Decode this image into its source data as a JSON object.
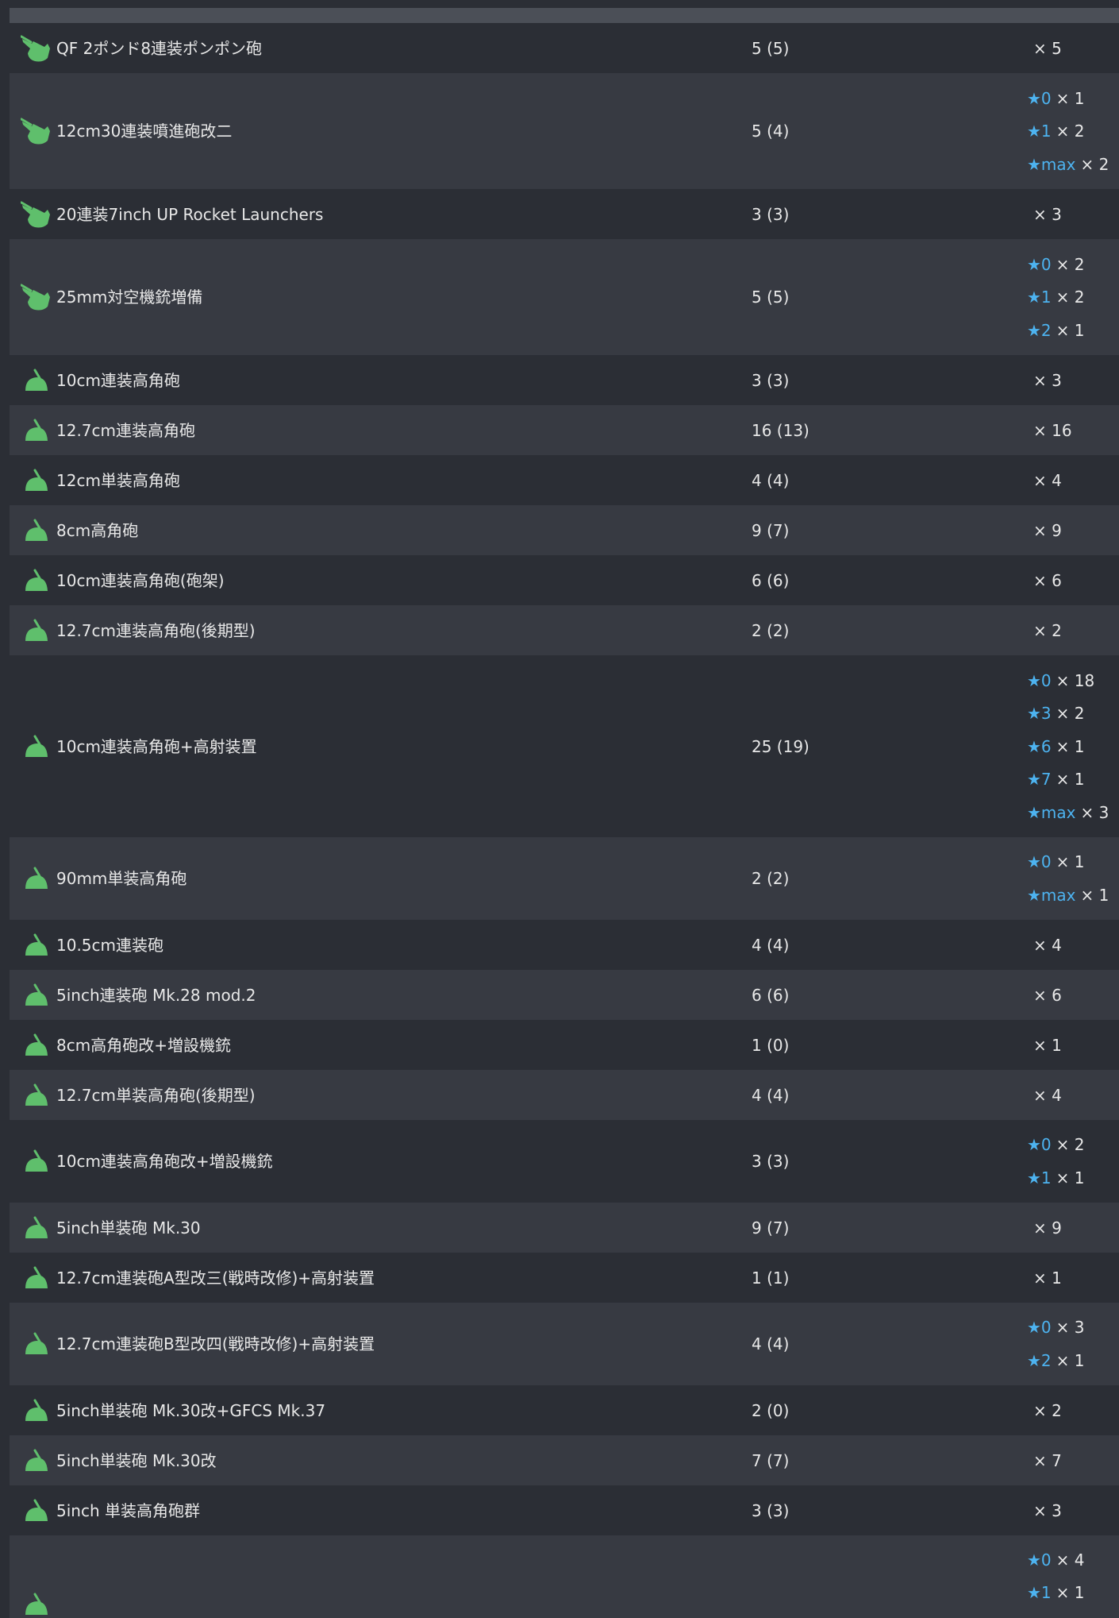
{
  "colors": {
    "background": "#2b2e35",
    "row_alt": "#373a42",
    "header_strip": "#4b4f57",
    "text": "#e8e8e8",
    "star": "#4db3f0",
    "icon_green": "#5fbf6c"
  },
  "rows": [
    {
      "icon": "machine-gun-icon",
      "name": "QF 2ポンド8連装ポンポン砲",
      "count": "5 (5)",
      "total": "× 5",
      "stars": []
    },
    {
      "icon": "machine-gun-icon",
      "name": "12cm30連装噴進砲改二",
      "count": "5 (4)",
      "total": "",
      "stars": [
        {
          "level": "★0",
          "qty": "× 1"
        },
        {
          "level": "★1",
          "qty": "× 2"
        },
        {
          "level": "★max",
          "qty": "× 2"
        }
      ]
    },
    {
      "icon": "machine-gun-icon",
      "name": "20連装7inch UP Rocket Launchers",
      "count": "3 (3)",
      "total": "× 3",
      "stars": []
    },
    {
      "icon": "machine-gun-icon",
      "name": "25mm対空機銃増備",
      "count": "5 (5)",
      "total": "",
      "stars": [
        {
          "level": "★0",
          "qty": "× 2"
        },
        {
          "level": "★1",
          "qty": "× 2"
        },
        {
          "level": "★2",
          "qty": "× 1"
        }
      ]
    },
    {
      "icon": "high-angle-gun-icon",
      "name": "10cm連装高角砲",
      "count": "3 (3)",
      "total": "× 3",
      "stars": []
    },
    {
      "icon": "high-angle-gun-icon",
      "name": "12.7cm連装高角砲",
      "count": "16 (13)",
      "total": "× 16",
      "stars": []
    },
    {
      "icon": "high-angle-gun-icon",
      "name": "12cm単装高角砲",
      "count": "4 (4)",
      "total": "× 4",
      "stars": []
    },
    {
      "icon": "high-angle-gun-icon",
      "name": "8cm高角砲",
      "count": "9 (7)",
      "total": "× 9",
      "stars": []
    },
    {
      "icon": "high-angle-gun-icon",
      "name": "10cm連装高角砲(砲架)",
      "count": "6 (6)",
      "total": "× 6",
      "stars": []
    },
    {
      "icon": "high-angle-gun-icon",
      "name": "12.7cm連装高角砲(後期型)",
      "count": "2 (2)",
      "total": "× 2",
      "stars": []
    },
    {
      "icon": "high-angle-gun-icon",
      "name": "10cm連装高角砲+高射装置",
      "count": "25 (19)",
      "total": "",
      "stars": [
        {
          "level": "★0",
          "qty": "× 18"
        },
        {
          "level": "★3",
          "qty": "× 2"
        },
        {
          "level": "★6",
          "qty": "× 1"
        },
        {
          "level": "★7",
          "qty": "× 1"
        },
        {
          "level": "★max",
          "qty": "× 3"
        }
      ]
    },
    {
      "icon": "high-angle-gun-icon",
      "name": "90mm単装高角砲",
      "count": "2 (2)",
      "total": "",
      "stars": [
        {
          "level": "★0",
          "qty": "× 1"
        },
        {
          "level": "★max",
          "qty": "× 1"
        }
      ]
    },
    {
      "icon": "high-angle-gun-icon",
      "name": "10.5cm連装砲",
      "count": "4 (4)",
      "total": "× 4",
      "stars": []
    },
    {
      "icon": "high-angle-gun-icon",
      "name": "5inch連装砲 Mk.28 mod.2",
      "count": "6 (6)",
      "total": "× 6",
      "stars": []
    },
    {
      "icon": "high-angle-gun-icon",
      "name": "8cm高角砲改+増設機銃",
      "count": "1 (0)",
      "total": "× 1",
      "stars": []
    },
    {
      "icon": "high-angle-gun-icon",
      "name": "12.7cm単装高角砲(後期型)",
      "count": "4 (4)",
      "total": "× 4",
      "stars": []
    },
    {
      "icon": "high-angle-gun-icon",
      "name": "10cm連装高角砲改+増設機銃",
      "count": "3 (3)",
      "total": "",
      "stars": [
        {
          "level": "★0",
          "qty": "× 2"
        },
        {
          "level": "★1",
          "qty": "× 1"
        }
      ]
    },
    {
      "icon": "high-angle-gun-icon",
      "name": "5inch単装砲 Mk.30",
      "count": "9 (7)",
      "total": "× 9",
      "stars": []
    },
    {
      "icon": "high-angle-gun-icon",
      "name": "12.7cm連装砲A型改三(戦時改修)+高射装置",
      "count": "1 (1)",
      "total": "× 1",
      "stars": []
    },
    {
      "icon": "high-angle-gun-icon",
      "name": "12.7cm連装砲B型改四(戦時改修)+高射装置",
      "count": "4 (4)",
      "total": "",
      "stars": [
        {
          "level": "★0",
          "qty": "× 3"
        },
        {
          "level": "★2",
          "qty": "× 1"
        }
      ]
    },
    {
      "icon": "high-angle-gun-icon",
      "name": "5inch単装砲 Mk.30改+GFCS Mk.37",
      "count": "2 (0)",
      "total": "× 2",
      "stars": []
    },
    {
      "icon": "high-angle-gun-icon",
      "name": "5inch単装砲 Mk.30改",
      "count": "7 (7)",
      "total": "× 7",
      "stars": []
    },
    {
      "icon": "high-angle-gun-icon",
      "name": "5inch 単装高角砲群",
      "count": "3 (3)",
      "total": "× 3",
      "stars": []
    },
    {
      "icon": "high-angle-gun-icon",
      "name": "",
      "count": "",
      "total": "",
      "stars": [
        {
          "level": "★0",
          "qty": "× 4"
        },
        {
          "level": "★1",
          "qty": "× 1"
        }
      ]
    }
  ]
}
